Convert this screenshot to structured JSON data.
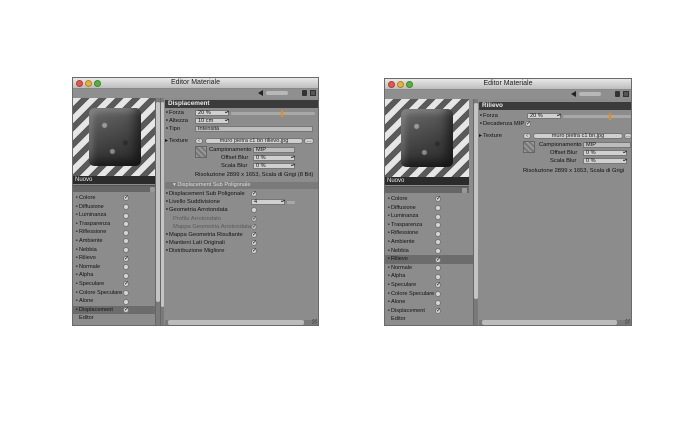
{
  "window_title": "Editor Materiale",
  "material_name": "Nuovo",
  "channels_left": [
    {
      "label": "Colore",
      "on": true
    },
    {
      "label": "Diffusione",
      "on": false
    },
    {
      "label": "Luminanza",
      "on": false
    },
    {
      "label": "Trasparenza",
      "on": false
    },
    {
      "label": "Riflessione",
      "on": false
    },
    {
      "label": "Ambiente",
      "on": false
    },
    {
      "label": "Nebbia",
      "on": false
    },
    {
      "label": "Rilievo",
      "on": true
    },
    {
      "label": "Normale",
      "on": false
    },
    {
      "label": "Alpha",
      "on": false
    },
    {
      "label": "Speculare",
      "on": true
    },
    {
      "label": "Colore Speculare",
      "on": false
    },
    {
      "label": "Alone",
      "on": false
    },
    {
      "label": "Displacement",
      "on": true
    }
  ],
  "editor_label": "Editor",
  "w1": {
    "section": "Displacement",
    "forza_label": "Forza",
    "forza_value": "20 %",
    "altezza_label": "Altezza",
    "altezza_value": "10 cm",
    "tipo_label": "Tipo",
    "tipo_value": "Intensità",
    "texture_label": "Texture",
    "texture_file": "muro pietra c1 bn rilievo.jpg",
    "camp_label": "Campionamento",
    "camp_value": "MIP",
    "offset_label": "Offset Blur",
    "offset_value": "0 %",
    "scala_label": "Scala Blur",
    "scala_value": "0 %",
    "info": "Risoluzione 2899 x 1653, Scala di Grigi (8 Bit)",
    "sub_section": "Displacement Sub Poligonale",
    "sub_rows": [
      {
        "label": "Displacement Sub Poligonale",
        "on": true,
        "dim": false
      },
      {
        "label": "Livello Suddivisione",
        "value": "4",
        "dim": false
      },
      {
        "label": "Geometria Arrotondata",
        "on": false,
        "dim": false
      },
      {
        "label": "Profilo Arrotondato",
        "on": true,
        "dim": true
      },
      {
        "label": "Mappa Geometria Arrotondata",
        "on": true,
        "dim": true
      },
      {
        "label": "Mappa Geometria Risultante",
        "on": true,
        "dim": false
      },
      {
        "label": "Mantieni Lati Originali",
        "on": true,
        "dim": false
      },
      {
        "label": "Distribuzione Migliore",
        "on": true,
        "dim": false
      }
    ]
  },
  "w2": {
    "section": "Rilievo",
    "forza_label": "Forza",
    "forza_value": "20 %",
    "decadenza_label": "Decadenza MIP",
    "texture_label": "Texture",
    "texture_file": "muro pietra c1 bn.jpg",
    "camp_label": "Campionamento",
    "camp_value": "MIP",
    "offset_label": "Offset Blur",
    "offset_value": "0 %",
    "scala_label": "Scala Blur",
    "scala_value": "0 %",
    "info": "Risoluzione 2899 x 1653, Scala di Grigi"
  },
  "colors": {
    "window_bg": "#8c8c8c",
    "section_bg": "#3b3b3b",
    "slider_knob": "#e0901a"
  }
}
